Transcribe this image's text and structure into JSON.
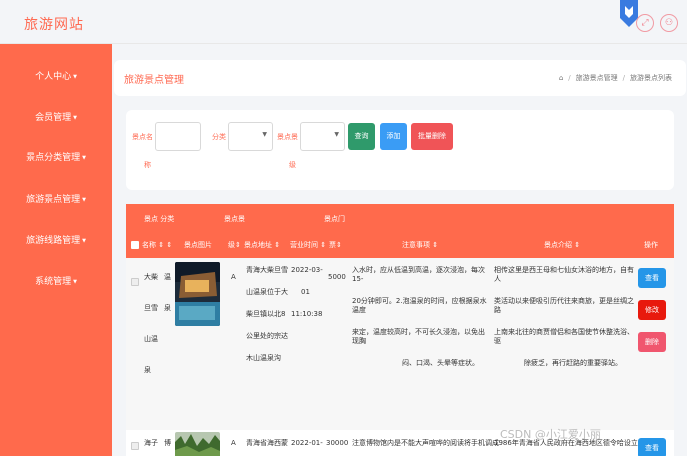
{
  "header": {
    "site_title": "旅游网站"
  },
  "sidebar": {
    "items": [
      {
        "label": "个人中心"
      },
      {
        "label": "会员管理"
      },
      {
        "label": "景点分类管理"
      },
      {
        "label": "旅游景点管理"
      },
      {
        "label": "旅游线路管理"
      },
      {
        "label": "系统管理"
      }
    ]
  },
  "page": {
    "title": "旅游景点管理",
    "breadcrumb": [
      "旅游景点管理",
      "旅游景点列表"
    ]
  },
  "filters": {
    "name_label_top": "景点名",
    "name_label_bottom": "称",
    "category_label": "分类",
    "level_label_top": "景点景",
    "level_label_bottom": "级",
    "query_button": "查询",
    "add_button": "添加",
    "batch_delete_button": "批量删除"
  },
  "table": {
    "group_headers": {
      "name_category": "景点 分类",
      "scenic_level": "景点景",
      "ticket": "景点门"
    },
    "columns": {
      "name": "名称",
      "image": "景点图片",
      "level": "级",
      "address": "景点地址",
      "hours": "营业时间",
      "price": "票",
      "notes": "注意事项",
      "intro": "景点介绍",
      "actions": "操作"
    },
    "rows": [
      {
        "name": [
          "大柴",
          "旦雪",
          "山温",
          "泉"
        ],
        "category": [
          "温",
          "泉"
        ],
        "level": "A",
        "address": [
          "青海大柴旦雪",
          "山温泉位于大",
          "柴旦镇以北8",
          "公里处的宗达",
          "木山温泉沟"
        ],
        "hours": [
          "2022-03-",
          "01",
          "11:10:38"
        ],
        "price": "5000",
        "notes": [
          "入水时，应从低温到高温，逐次浸泡，每次15-",
          "20分钟即可。2.泡温泉的时间，应根据泉水温度",
          "来定，温度较高时，不可长久浸泡，以免出现胸",
          "闷、口渴、头晕等症状。"
        ],
        "intro": [
          "相传这里是西王母和七仙女沐浴的地方，自有人",
          "类活动以来便吸引历代往来商旅，更是丝绸之路",
          "上南来北往的商贾僧侣和各国使节休整洗浴、驱",
          "除疲乏，再行赶路的重要驿站。"
        ],
        "view_button": "查看",
        "edit_button": "修改",
        "delete_button": "删除"
      },
      {
        "name": [
          "海子"
        ],
        "category": [
          "博"
        ],
        "level": "A",
        "address": [
          "青海省海西蒙"
        ],
        "hours": [
          "2022-01-"
        ],
        "price": "30000",
        "notes": [
          "注意博物馆内是不能大声喧哗的阅读将手机调成"
        ],
        "intro": [
          "1986年青海省人民政府在海西地区德令哈设立"
        ],
        "view_button": "查看"
      }
    ]
  },
  "watermark": "CSDN @小江爱小丽",
  "colors": {
    "accent": "#ff6a4c",
    "query": "#2f9a6b",
    "add": "#3a9cf5",
    "batch_delete": "#f05457",
    "edit": "#e8190d",
    "delete": "#f0566e",
    "view": "#2596e8"
  }
}
